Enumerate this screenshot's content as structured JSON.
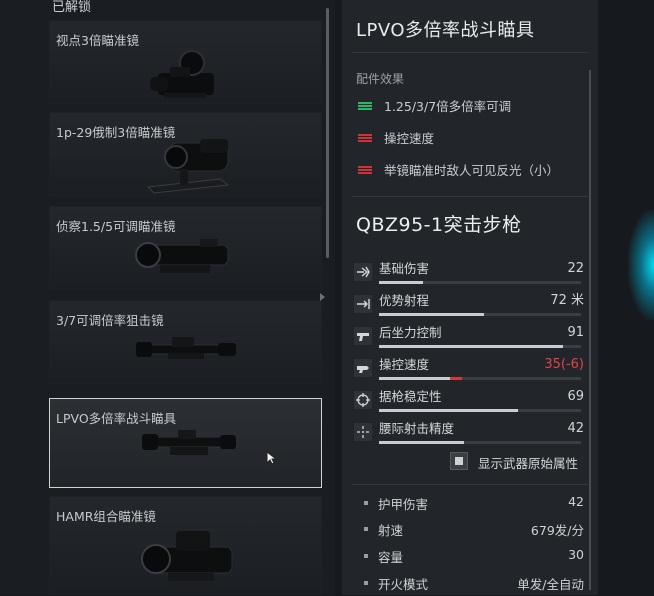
{
  "left_panel": {
    "section_header": "已解锁",
    "attachments": [
      {
        "name": "视点3倍瞄准镜"
      },
      {
        "name": "1p-29俄制3倍瞄准镜"
      },
      {
        "name": "侦察1.5/5可调瞄准镜"
      },
      {
        "name": "3/7可调倍率狙击镜"
      },
      {
        "name": "LPVO多倍率战斗瞄具",
        "selected": true
      },
      {
        "name": "HAMR组合瞄准镜"
      }
    ]
  },
  "detail": {
    "title": "LPVO多倍率战斗瞄具",
    "effects_header": "配件效果",
    "effects": [
      {
        "text": "1.25/3/7倍多倍率可调",
        "kind": "positive",
        "color": "#2fb56a"
      },
      {
        "text": "操控速度",
        "kind": "negative",
        "color": "#c9353a"
      },
      {
        "text": "举镜瞄准时敌人可见反光（小）",
        "kind": "negative",
        "color": "#c9353a"
      }
    ],
    "weapon_title": "QBZ95-1突击步枪",
    "stats": [
      {
        "icon": "damage-icon",
        "label": "基础伤害",
        "value": "22",
        "fill": 0.22
      },
      {
        "icon": "range-icon",
        "label": "优势射程",
        "value": "72 米",
        "fill": 0.52
      },
      {
        "icon": "pistol-grip-icon",
        "label": "后坐力控制",
        "value": "91",
        "fill": 0.91
      },
      {
        "icon": "handling-icon",
        "label": "操控速度",
        "value": "35(-6)",
        "fill": 0.35,
        "penalty": 0.06,
        "value_color": "#e0454a"
      },
      {
        "icon": "crosshair-icon",
        "label": "据枪稳定性",
        "value": "69",
        "fill": 0.69
      },
      {
        "icon": "hipfire-icon",
        "label": "腰际射击精度",
        "value": "42",
        "fill": 0.42
      }
    ],
    "toggle_label": "显示武器原始属性",
    "properties": [
      {
        "label": "护甲伤害",
        "value": "42"
      },
      {
        "label": "射速",
        "value": "679发/分"
      },
      {
        "label": "容量",
        "value": "30"
      },
      {
        "label": "开火模式",
        "value": "单发/全自动"
      }
    ]
  }
}
